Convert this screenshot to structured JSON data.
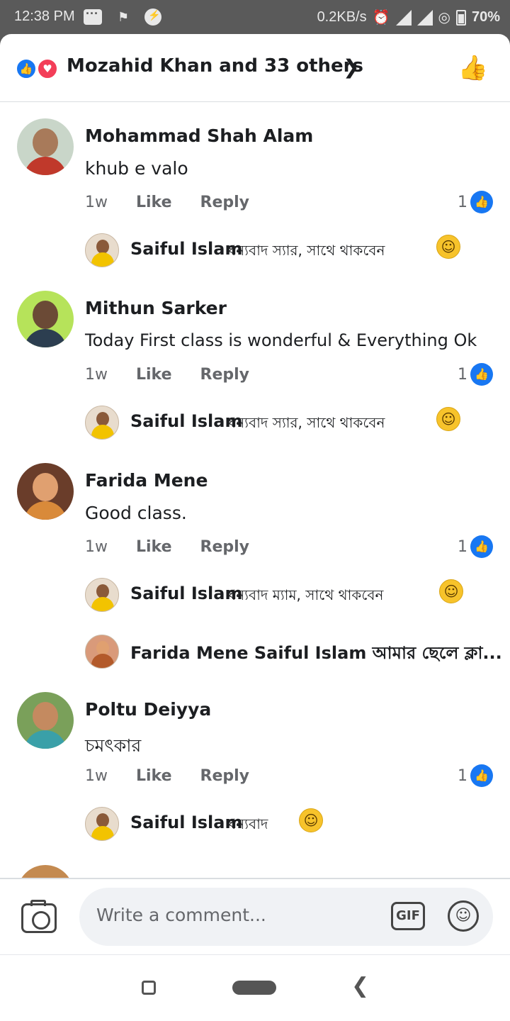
{
  "status_bar": {
    "time": "12:38 PM",
    "network_speed": "0.2KB/s",
    "battery": "70%",
    "icons": [
      "message-icon",
      "flag-icon",
      "messenger-icon",
      "alarm-icon",
      "signal-icon",
      "signal-4g-icon",
      "wifi-hotspot-icon",
      "battery-icon"
    ]
  },
  "reactions": {
    "summary": "Mozahid Khan and 33 others",
    "icons": [
      "like-reaction-icon",
      "love-reaction-icon"
    ]
  },
  "comments": [
    {
      "author": "Mohammad Shah Alam",
      "text": "khub e valo",
      "time": "1w",
      "like_label": "Like",
      "reply_label": "Reply",
      "like_count": "1",
      "replies": [
        {
          "author": "Saiful Islam",
          "text": "ধন্যবাদ স্যার, সাথে থাকবেন"
        }
      ]
    },
    {
      "author": "Mithun Sarker",
      "text": "Today First class is  wonderful & Everything Ok",
      "time": "1w",
      "like_label": "Like",
      "reply_label": "Reply",
      "like_count": "1",
      "replies": [
        {
          "author": "Saiful Islam",
          "text": "ধন্যবাদ স্যার, সাথে থাকবেন"
        }
      ]
    },
    {
      "author": "Farida Mene",
      "text": "Good class.",
      "time": "1w",
      "like_label": "Like",
      "reply_label": "Reply",
      "like_count": "1",
      "replies": [
        {
          "author": "Saiful Islam",
          "text": "ধন্যবাদ ম্যাম, সাথে থাকবেন"
        },
        {
          "author": "Farida Mene",
          "text": "Saiful Islam আমার ছেলে ক্লা..."
        }
      ]
    },
    {
      "author": "Poltu Deiyya",
      "text": "চমৎকার",
      "time": "1w",
      "like_label": "Like",
      "reply_label": "Reply",
      "like_count": "1",
      "replies": [
        {
          "author": "Saiful Islam",
          "text": "ধন্যবাদ"
        }
      ]
    }
  ],
  "composer": {
    "placeholder": "Write a comment...",
    "gif_label": "GIF"
  },
  "colors": {
    "facebook_blue": "#1877f2",
    "love_red": "#f33e58",
    "status_bar_bg": "#5a5a5a"
  }
}
